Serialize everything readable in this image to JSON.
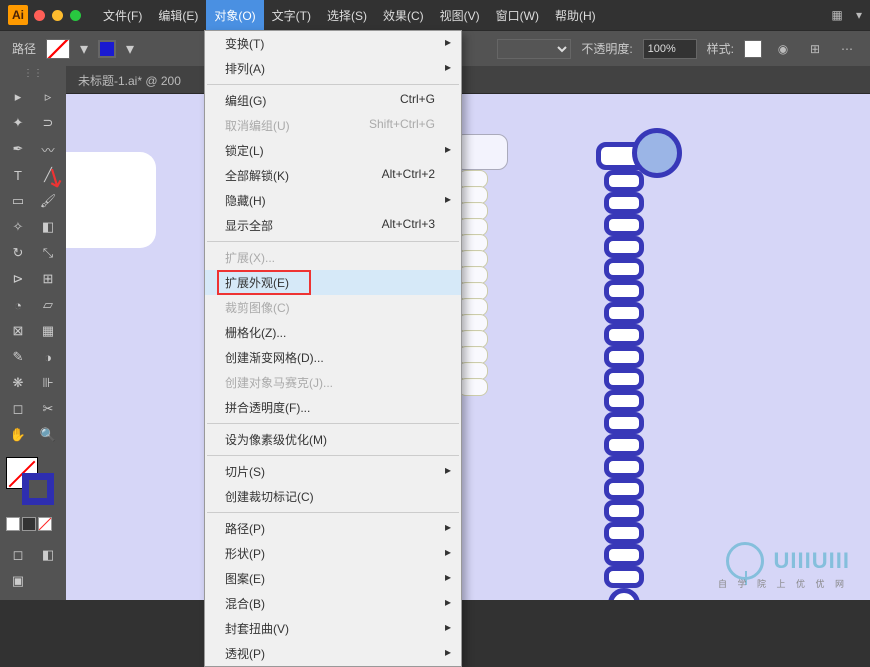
{
  "app": {
    "logo": "Ai"
  },
  "menubar": [
    "文件(F)",
    "编辑(E)",
    "对象(O)",
    "文字(T)",
    "选择(S)",
    "效果(C)",
    "视图(V)",
    "窗口(W)",
    "帮助(H)"
  ],
  "menubar_active_index": 2,
  "control": {
    "path_label": "路径",
    "opacity_label": "不透明度:",
    "opacity_value": "100%",
    "style_label": "样式:"
  },
  "doc_tab": "未标题-1.ai* @ 200",
  "dropdown": [
    {
      "label": "变换(T)",
      "sub": true
    },
    {
      "label": "排列(A)",
      "sub": true
    },
    {
      "sep": true
    },
    {
      "label": "编组(G)",
      "shortcut": "Ctrl+G"
    },
    {
      "label": "取消编组(U)",
      "shortcut": "Shift+Ctrl+G",
      "disabled": true
    },
    {
      "label": "锁定(L)",
      "sub": true
    },
    {
      "label": "全部解锁(K)",
      "shortcut": "Alt+Ctrl+2"
    },
    {
      "label": "隐藏(H)",
      "sub": true
    },
    {
      "label": "显示全部",
      "shortcut": "Alt+Ctrl+3"
    },
    {
      "sep": true
    },
    {
      "label": "扩展(X)...",
      "disabled": true
    },
    {
      "label": "扩展外观(E)",
      "hover": true,
      "highlight": true
    },
    {
      "label": "裁剪图像(C)",
      "disabled": true
    },
    {
      "label": "栅格化(Z)..."
    },
    {
      "label": "创建渐变网格(D)..."
    },
    {
      "label": "创建对象马赛克(J)...",
      "disabled": true
    },
    {
      "label": "拼合透明度(F)..."
    },
    {
      "sep": true
    },
    {
      "label": "设为像素级优化(M)"
    },
    {
      "sep": true
    },
    {
      "label": "切片(S)",
      "sub": true
    },
    {
      "label": "创建裁切标记(C)"
    },
    {
      "sep": true
    },
    {
      "label": "路径(P)",
      "sub": true
    },
    {
      "label": "形状(P)",
      "sub": true
    },
    {
      "label": "图案(E)",
      "sub": true
    },
    {
      "label": "混合(B)",
      "sub": true
    },
    {
      "label": "封套扭曲(V)",
      "sub": true
    },
    {
      "label": "透视(P)",
      "sub": true
    }
  ],
  "watermark": {
    "main": "UIIIUIII",
    "sub": "自 学 院 上 优 优 网"
  }
}
